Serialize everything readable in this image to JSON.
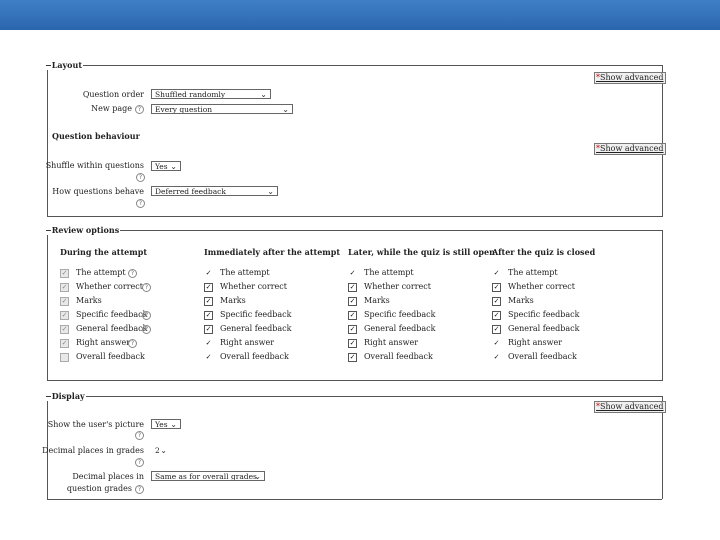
{
  "layout": {
    "legend": "Layout",
    "show_advanced": "Show advanced",
    "question_order": {
      "label": "Question order",
      "value": "Shuffled randomly"
    },
    "new_page": {
      "label": "New page",
      "value": "Every question"
    }
  },
  "question_behaviour": {
    "heading": "Question behaviour",
    "show_advanced": "Show advanced",
    "shuffle": {
      "label": "Shuffle within questions",
      "value": "Yes"
    },
    "behave": {
      "label": "How questions behave",
      "value": "Deferred feedback"
    }
  },
  "review": {
    "legend": "Review options",
    "columns": [
      {
        "title": "During the attempt"
      },
      {
        "title": "Immediately after the attempt"
      },
      {
        "title": "Later, while the quiz is still open"
      },
      {
        "title": "After the quiz is closed"
      }
    ],
    "items": [
      "The attempt",
      "Whether correct",
      "Marks",
      "Specific feedback",
      "General feedback",
      "Right answer",
      "Overall feedback"
    ],
    "check_mark": "✓"
  },
  "display": {
    "legend": "Display",
    "show_advanced": "Show advanced",
    "picture": {
      "label": "Show the user's picture",
      "value": "Yes"
    },
    "decimal": {
      "label": "Decimal places in grades",
      "value": "2"
    },
    "decimal_q": {
      "label_line1": "Decimal places in",
      "label_line2": "question grades",
      "value": "Same as for overall grades"
    }
  },
  "glyphs": {
    "help": "?",
    "dropdown": "⌄",
    "star": "*"
  }
}
